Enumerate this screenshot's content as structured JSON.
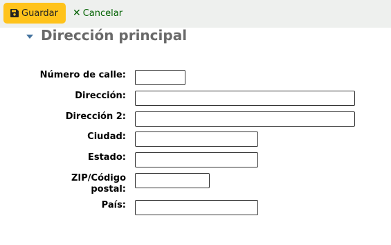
{
  "toolbar": {
    "save_label": "Guardar",
    "cancel_label": "Cancelar",
    "save_color": "#ffc31b",
    "cancel_color": "#006100"
  },
  "section": {
    "title": "Dirección principal",
    "expanded": true
  },
  "form": {
    "street_number": {
      "label": "Número de calle:",
      "value": ""
    },
    "address": {
      "label": "Dirección:",
      "value": ""
    },
    "address2": {
      "label": "Dirección 2:",
      "value": ""
    },
    "city": {
      "label": "Ciudad:",
      "value": ""
    },
    "state": {
      "label": "Estado:",
      "value": ""
    },
    "zip": {
      "label_line1": "ZIP/Código",
      "label_line2": "postal:",
      "value": ""
    },
    "country": {
      "label": "País:",
      "value": ""
    }
  }
}
